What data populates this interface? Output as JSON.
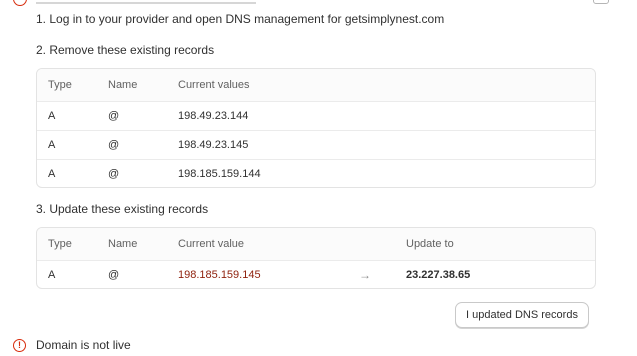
{
  "steps": {
    "step1": "1. Log in to your provider and open DNS management for getsimplynest.com",
    "step2": "2. Remove these existing records",
    "step3": "3. Update these existing records"
  },
  "remove_table": {
    "headers": {
      "type": "Type",
      "name": "Name",
      "values": "Current values"
    },
    "rows": [
      {
        "type": "A",
        "name": "@",
        "value": "198.49.23.144"
      },
      {
        "type": "A",
        "name": "@",
        "value": "198.49.23.145"
      },
      {
        "type": "A",
        "name": "@",
        "value": "198.185.159.144"
      }
    ]
  },
  "update_table": {
    "headers": {
      "type": "Type",
      "name": "Name",
      "current": "Current value",
      "update": "Update to"
    },
    "rows": [
      {
        "type": "A",
        "name": "@",
        "current": "198.185.159.145",
        "arrow": "→",
        "update": "23.227.38.65"
      }
    ]
  },
  "actions": {
    "updated_button": "I updated DNS records"
  },
  "status": {
    "icon": "alert-circle-icon",
    "text": "Domain is not live",
    "color": "#d72c0d"
  }
}
